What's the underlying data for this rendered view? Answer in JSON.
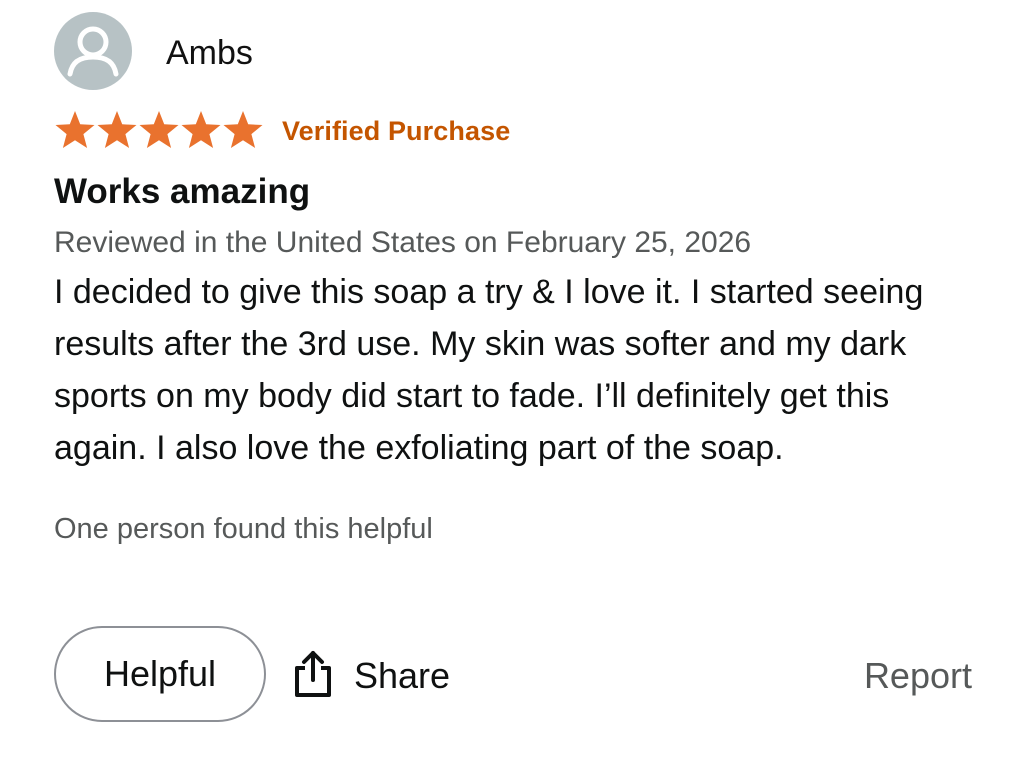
{
  "review": {
    "profile_name": "Ambs",
    "rating": 5,
    "rating_max": 5,
    "verified_label": "Verified Purchase",
    "title": "Works amazing",
    "meta": "Reviewed in the United States on February 25, 2026",
    "body": "I decided to give this soap a try & I love it. I started seeing results after the 3rd use. My skin was softer and my dark sports on my body did start to fade. I’ll definitely get this again. I also love the exfoliating part of the soap.",
    "helpful_count_text": "One person found this helpful"
  },
  "actions": {
    "helpful_label": "Helpful",
    "share_label": "Share",
    "report_label": "Report"
  },
  "icons": {
    "avatar": "user-avatar-icon",
    "star": "star-icon",
    "share": "share-icon"
  },
  "colors": {
    "star": "#e9722e",
    "verified": "#c45500",
    "meta_text": "#565959",
    "avatar_bg": "#b7c2c5"
  }
}
